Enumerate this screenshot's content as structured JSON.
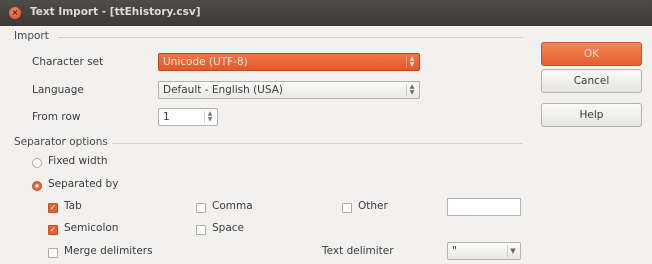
{
  "window": {
    "title": "Text Import - [ttEhistory.csv]"
  },
  "import": {
    "section": "Import",
    "character_set_label": "Character set",
    "character_set_value": "Unicode (UTF-8)",
    "language_label": "Language",
    "language_value": "Default - English (USA)",
    "from_row_label": "From row",
    "from_row_value": "1"
  },
  "separator": {
    "section": "Separator options",
    "fixed_width": "Fixed width",
    "separated_by": "Separated by",
    "mode": "separated_by",
    "tab": {
      "label": "Tab",
      "checked": true
    },
    "comma": {
      "label": "Comma",
      "checked": false
    },
    "other": {
      "label": "Other",
      "checked": false,
      "value": ""
    },
    "semicolon": {
      "label": "Semicolon",
      "checked": true
    },
    "space": {
      "label": "Space",
      "checked": false
    },
    "merge": {
      "label": "Merge delimiters",
      "checked": false
    },
    "text_delimiter_label": "Text delimiter",
    "text_delimiter_value": "\""
  },
  "buttons": {
    "ok": "OK",
    "cancel": "Cancel",
    "help": "Help"
  },
  "colors": {
    "accent": "#e5602f",
    "titlebar": "#3f3e3a",
    "background": "#f2f1f0"
  }
}
